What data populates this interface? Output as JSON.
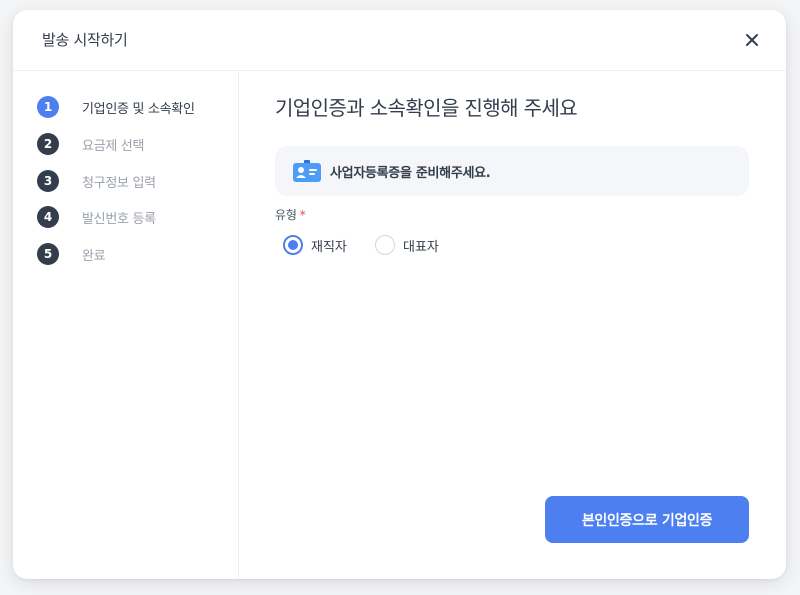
{
  "dialog": {
    "title": "발송 시작하기"
  },
  "steps": [
    {
      "number": "1",
      "label": "기업인증 및 소속확인",
      "active": true
    },
    {
      "number": "2",
      "label": "요금제 선택",
      "active": false
    },
    {
      "number": "3",
      "label": "청구정보 입력",
      "active": false
    },
    {
      "number": "4",
      "label": "발신번호 등록",
      "active": false
    },
    {
      "number": "5",
      "label": "완료",
      "active": false
    }
  ],
  "main": {
    "heading": "기업인증과 소속확인을 진행해 주세요",
    "notice": {
      "icon": "id-card-icon",
      "text": "사업자등록증을 준비해주세요."
    },
    "type_field": {
      "label": "유형",
      "required_mark": "*",
      "options": [
        {
          "label": "재직자",
          "selected": true
        },
        {
          "label": "대표자",
          "selected": false
        }
      ]
    },
    "submit_label": "본인인증으로 기업인증"
  },
  "colors": {
    "accent": "#4d7ff0",
    "step_badge": "#333d4b",
    "required": "#e5484d"
  }
}
